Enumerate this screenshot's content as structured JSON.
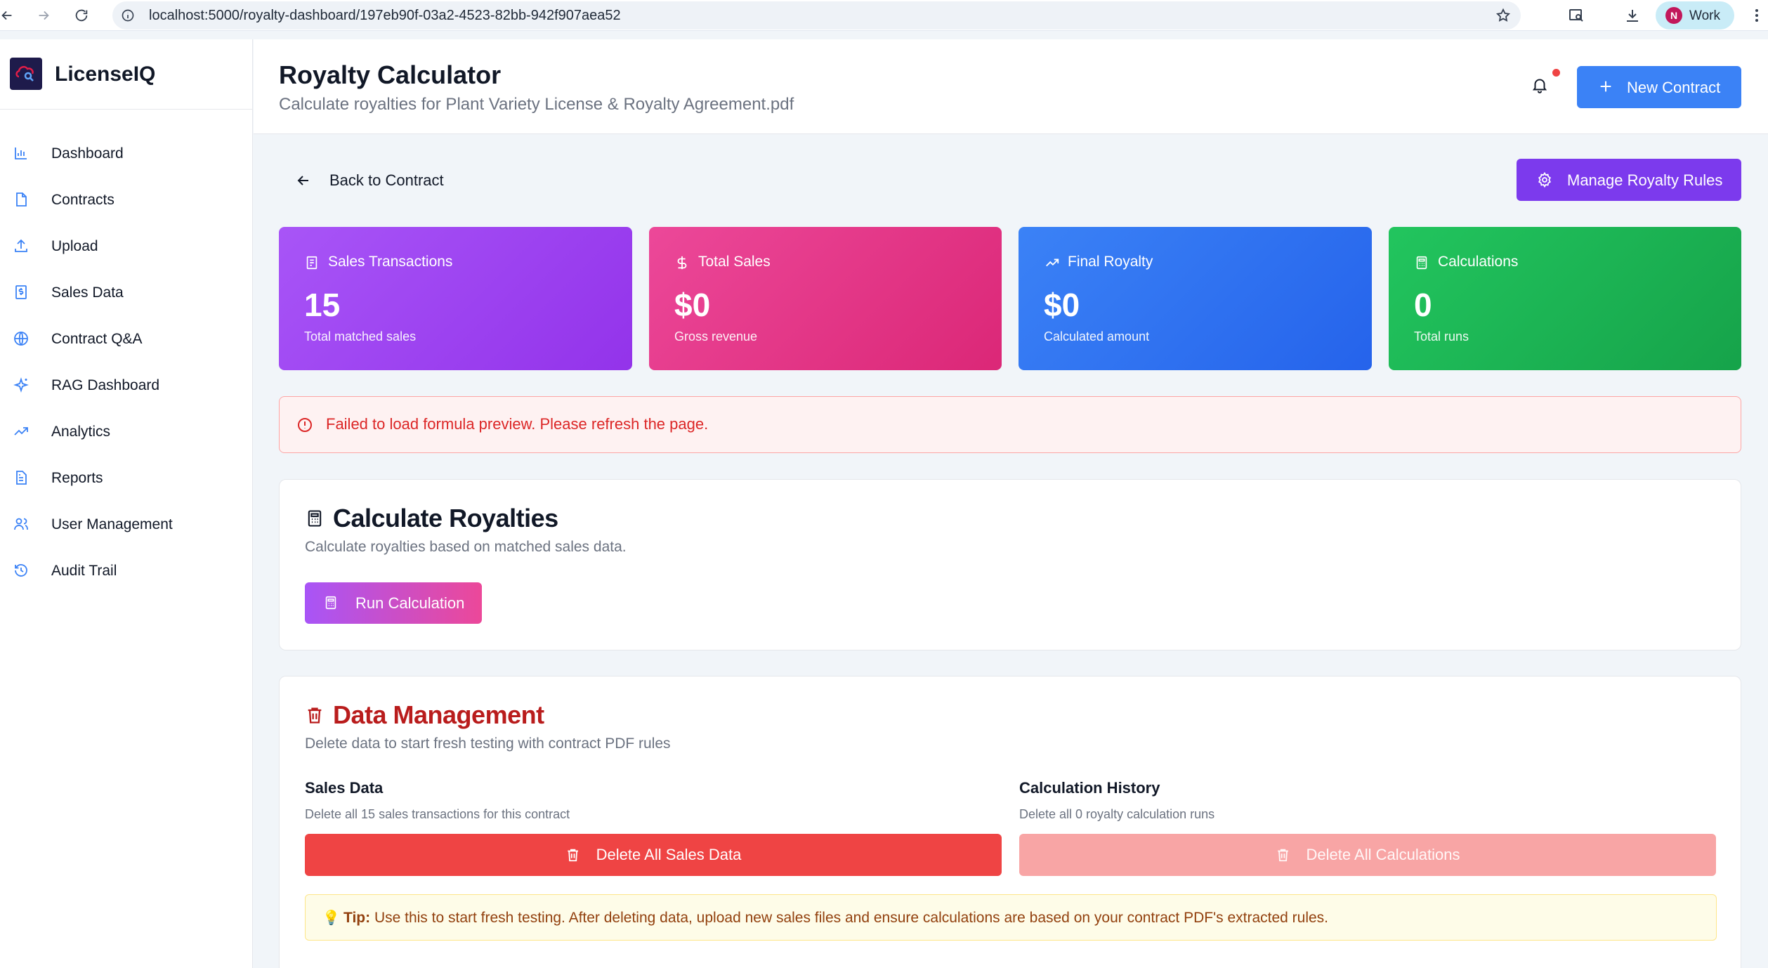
{
  "browser": {
    "url": "localhost:5000/royalty-dashboard/197eb90f-03a2-4523-82bb-942f907aea52",
    "profile_initial": "N",
    "profile_name": "Work"
  },
  "sidebar": {
    "brand": "LicenseIQ",
    "items": [
      {
        "label": "Dashboard",
        "icon": "bar-chart-icon"
      },
      {
        "label": "Contracts",
        "icon": "file-icon"
      },
      {
        "label": "Upload",
        "icon": "upload-icon"
      },
      {
        "label": "Sales Data",
        "icon": "dollar-file-icon"
      },
      {
        "label": "Contract Q&A",
        "icon": "globe-icon"
      },
      {
        "label": "RAG Dashboard",
        "icon": "sparkles-icon"
      },
      {
        "label": "Analytics",
        "icon": "trending-up-icon"
      },
      {
        "label": "Reports",
        "icon": "file-text-icon"
      },
      {
        "label": "User Management",
        "icon": "users-icon"
      },
      {
        "label": "Audit Trail",
        "icon": "history-icon"
      }
    ]
  },
  "header": {
    "title": "Royalty Calculator",
    "subtitle": "Calculate royalties for Plant Variety License & Royalty Agreement.pdf",
    "new_contract_label": "New Contract"
  },
  "actions": {
    "back_label": "Back to Contract",
    "manage_rules_label": "Manage Royalty Rules"
  },
  "stats": [
    {
      "label": "Sales Transactions",
      "value": "15",
      "sub": "Total matched sales",
      "color": "#9333ea"
    },
    {
      "label": "Total Sales",
      "value": "$0",
      "sub": "Gross revenue",
      "color": "#db2777"
    },
    {
      "label": "Final Royalty",
      "value": "$0",
      "sub": "Calculated amount",
      "color": "#2563eb"
    },
    {
      "label": "Calculations",
      "value": "0",
      "sub": "Total runs",
      "color": "#16a34a"
    }
  ],
  "alert": {
    "message": "Failed to load formula preview. Please refresh the page."
  },
  "calculate": {
    "title": "Calculate Royalties",
    "description": "Calculate royalties based on matched sales data.",
    "run_label": "Run Calculation"
  },
  "data_management": {
    "title": "Data Management",
    "description": "Delete data to start fresh testing with contract PDF rules",
    "sales": {
      "title": "Sales Data",
      "description": "Delete all 15 sales transactions for this contract",
      "button_label": "Delete All Sales Data"
    },
    "history": {
      "title": "Calculation History",
      "description": "Delete all 0 royalty calculation runs",
      "button_label": "Delete All Calculations"
    },
    "tip_label": "Tip:",
    "tip_text": " Use this to start fresh testing. After deleting data, upload new sales files and ensure calculations are based on your contract PDF's extracted rules."
  },
  "colors": {
    "accent_blue": "#3b82f6",
    "accent_purple": "#7c3aed",
    "danger": "#ef4444"
  }
}
